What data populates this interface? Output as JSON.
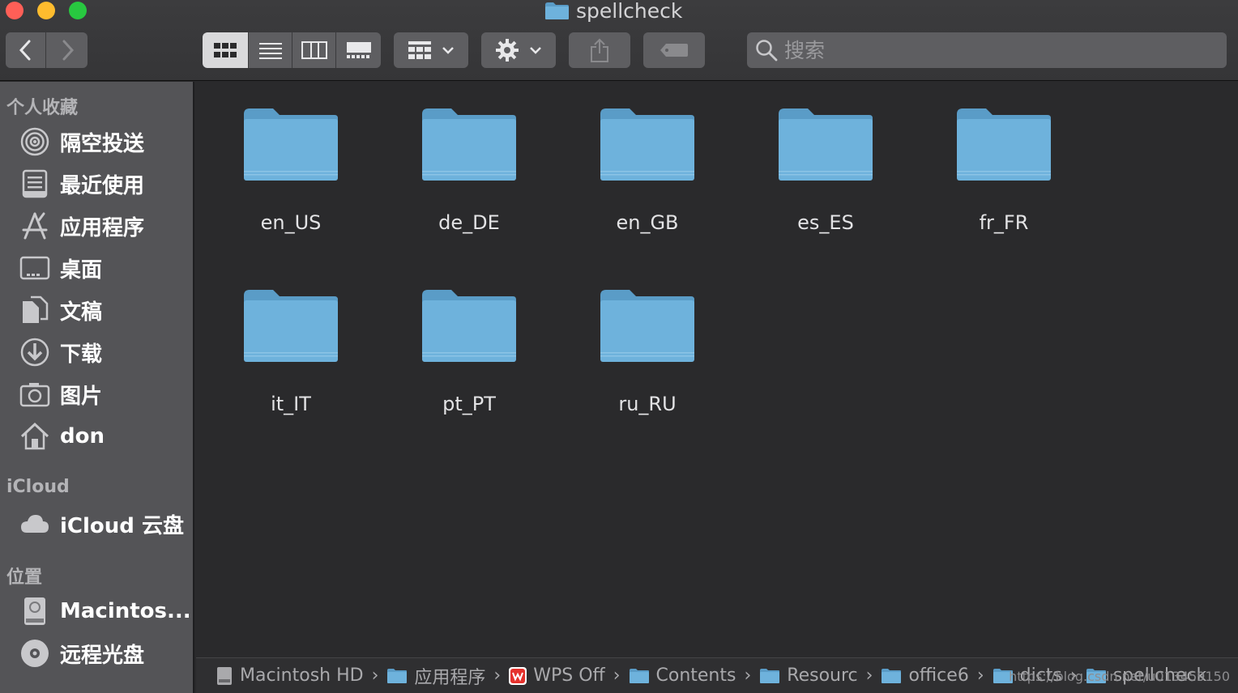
{
  "window": {
    "title": "spellcheck"
  },
  "toolbar": {
    "back_icon": "chevron-left-icon",
    "forward_icon": "chevron-right-icon",
    "view_modes": [
      "icon-view",
      "list-view",
      "column-view",
      "gallery-view"
    ],
    "active_view": "icon-view",
    "group_icon": "group-grid-icon",
    "action_icon": "gear-icon",
    "share_icon": "share-icon",
    "tag_icon": "tag-icon"
  },
  "search": {
    "placeholder": "搜索"
  },
  "sidebar": {
    "favorites_heading": "个人收藏",
    "favorites": [
      {
        "label": "隔空投送",
        "icon": "airdrop-icon"
      },
      {
        "label": "最近使用",
        "icon": "recents-icon"
      },
      {
        "label": "应用程序",
        "icon": "applications-icon"
      },
      {
        "label": "桌面",
        "icon": "desktop-icon"
      },
      {
        "label": "文稿",
        "icon": "documents-icon"
      },
      {
        "label": "下载",
        "icon": "downloads-icon"
      },
      {
        "label": "图片",
        "icon": "camera-icon"
      },
      {
        "label": "don",
        "icon": "home-icon"
      }
    ],
    "icloud_heading": "iCloud",
    "icloud": [
      {
        "label": "iCloud 云盘",
        "icon": "cloud-icon"
      }
    ],
    "locations_heading": "位置",
    "locations": [
      {
        "label": "Macintos...",
        "icon": "hard-drive-icon"
      },
      {
        "label": "远程光盘",
        "icon": "optical-disc-icon"
      }
    ]
  },
  "folders": [
    {
      "name": "en_US"
    },
    {
      "name": "de_DE"
    },
    {
      "name": "en_GB"
    },
    {
      "name": "es_ES"
    },
    {
      "name": "fr_FR"
    },
    {
      "name": "it_IT"
    },
    {
      "name": "pt_PT"
    },
    {
      "name": "ru_RU"
    }
  ],
  "pathbar": [
    {
      "label": "Macintosh HD",
      "icon": "hard-drive-icon"
    },
    {
      "label": "应用程序",
      "icon": "folder-icon"
    },
    {
      "label": "WPS Off",
      "icon": "wps-app-icon"
    },
    {
      "label": "Contents",
      "icon": "folder-icon"
    },
    {
      "label": "Resourc",
      "icon": "folder-icon"
    },
    {
      "label": "office6",
      "icon": "folder-icon"
    },
    {
      "label": "dicts",
      "icon": "folder-icon"
    },
    {
      "label": "spellcheck",
      "icon": "folder-icon"
    }
  ],
  "watermark": "https://blog.csdn.net/u013459150",
  "colors": {
    "folder": "#6eb2dc",
    "folder_tab": "#5a9cc7",
    "sidebar_bg": "#545457",
    "content_bg": "#2a2a2c"
  }
}
